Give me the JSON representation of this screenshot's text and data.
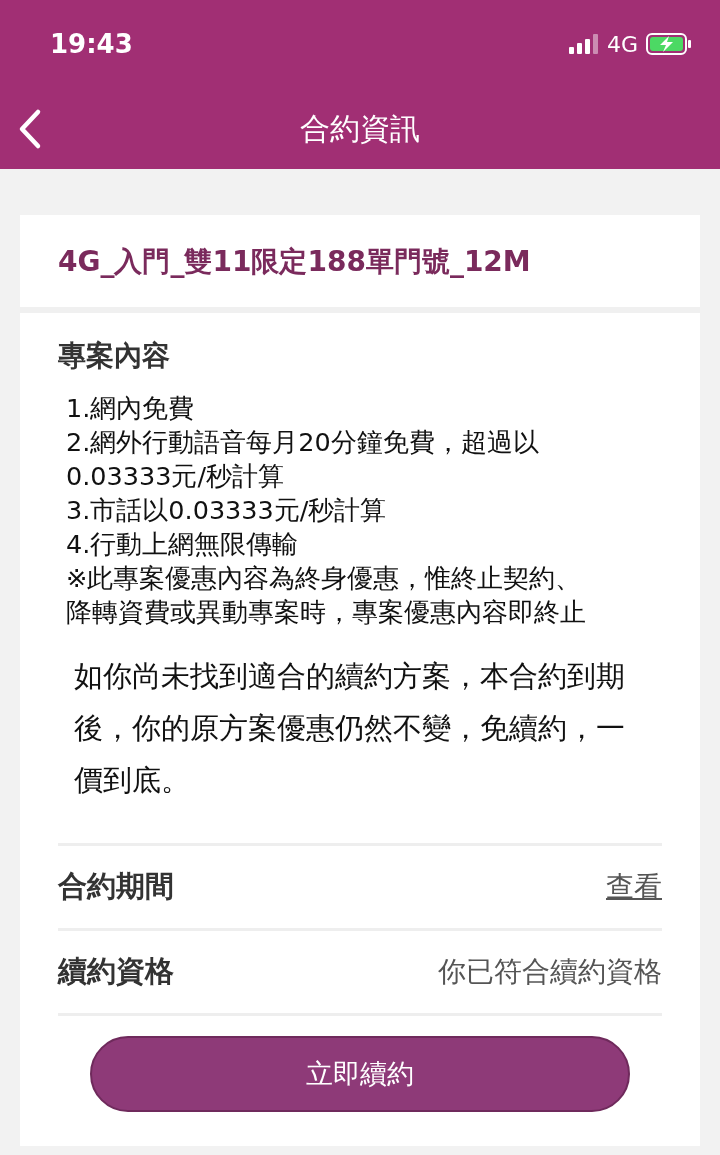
{
  "status_bar": {
    "time": "19:43",
    "network": "4G"
  },
  "header": {
    "title": "合約資訊"
  },
  "plan": {
    "name": "4G_入門_雙11限定188單門號_12M"
  },
  "content": {
    "heading": "專案內容",
    "lines": [
      "1.網內免費",
      "2.網外行動語音每月20分鐘免費，超過以",
      "0.03333元/秒計算",
      "3.市話以0.03333元/秒計算",
      "4.行動上網無限傳輸",
      "※此專案優惠內容為終身優惠，惟終止契約、",
      "降轉資費或異動專案時，專案優惠內容即終止"
    ],
    "notice": "如你尚未找到適合的續約方案，本合約到期後，你的原方案優惠仍然不變，免續約，一價到底。"
  },
  "rows": [
    {
      "label": "合約期間",
      "value": "查看",
      "kind": "link"
    },
    {
      "label": "續約資格",
      "value": "你已符合續約資格",
      "kind": "text"
    }
  ],
  "button": {
    "label": "立即續約"
  }
}
